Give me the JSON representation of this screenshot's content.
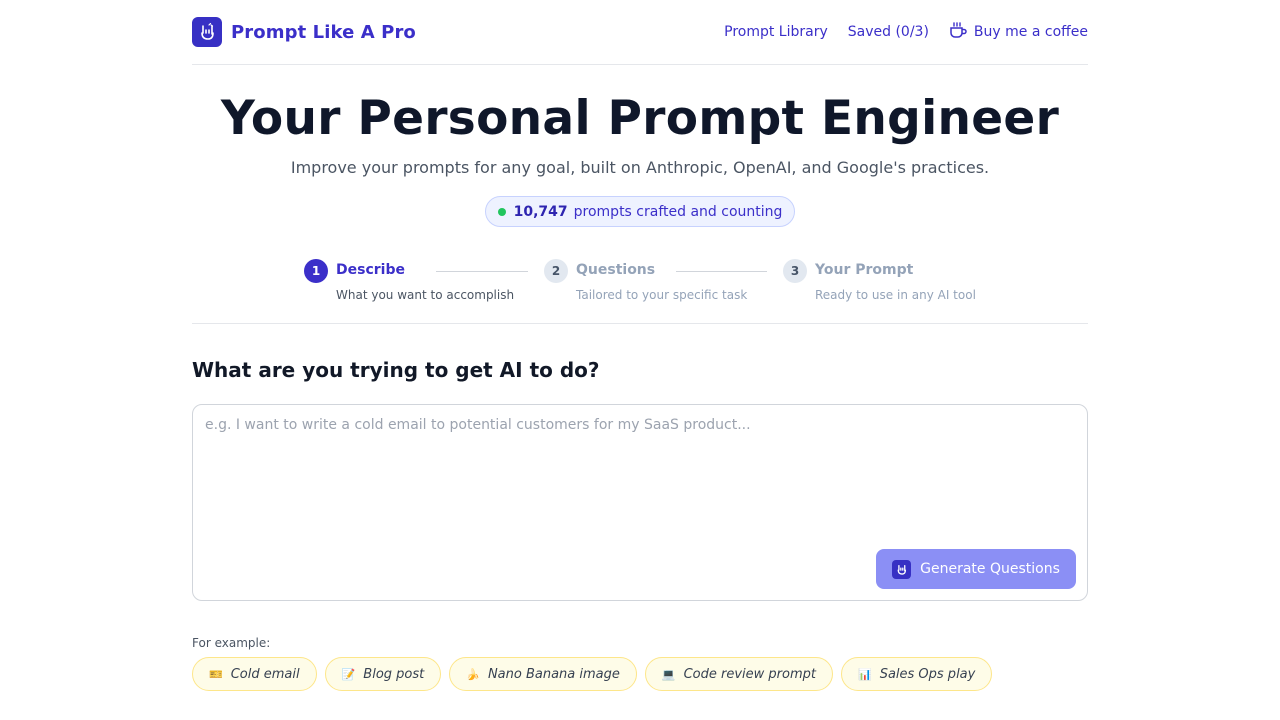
{
  "header": {
    "brand": "Prompt Like A Pro",
    "nav": {
      "library": "Prompt Library",
      "saved": "Saved (0/3)",
      "coffee": "Buy me a coffee"
    }
  },
  "hero": {
    "title": "Your Personal Prompt Engineer",
    "subtitle": "Improve your prompts for any goal, built on Anthropic, OpenAI, and Google's practices.",
    "counter_value": "10,747",
    "counter_text": "prompts crafted and counting"
  },
  "steps": [
    {
      "num": "1",
      "label": "Describe",
      "desc": "What you want to accomplish",
      "state": "active"
    },
    {
      "num": "2",
      "label": "Questions",
      "desc": "Tailored to your specific task",
      "state": "inactive"
    },
    {
      "num": "3",
      "label": "Your Prompt",
      "desc": "Ready to use in any AI tool",
      "state": "inactive"
    }
  ],
  "main": {
    "question": "What are you trying to get AI to do?",
    "textarea_placeholder": "e.g. I want to write a cold email to potential customers for my SaaS product...",
    "textarea_value": "",
    "generate_button": "Generate Questions",
    "examples_label": "For example:",
    "examples": [
      {
        "icon": "🎫",
        "label": "Cold email"
      },
      {
        "icon": "📝",
        "label": "Blog post"
      },
      {
        "icon": "🍌",
        "label": "Nano Banana image"
      },
      {
        "icon": "💻",
        "label": "Code review prompt"
      },
      {
        "icon": "📊",
        "label": "Sales Ops play"
      }
    ]
  },
  "colors": {
    "brand": "#3b2fc9",
    "button_disabled": "#8b8ff5",
    "chip_bg": "#fefce8",
    "status_dot": "#22c55e"
  },
  "icons": {
    "logo": "rock-hand-icon",
    "coffee": "coffee-cup-icon"
  }
}
